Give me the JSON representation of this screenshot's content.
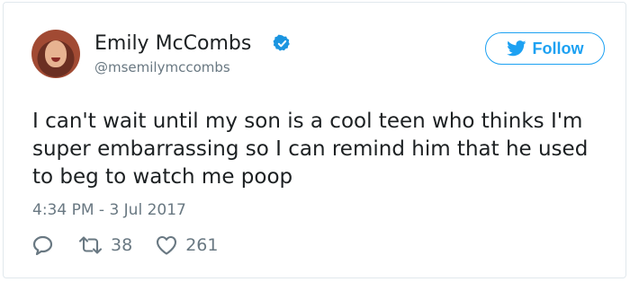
{
  "user": {
    "display_name": "Emily McCombs",
    "handle": "@msemilymccombs",
    "verified": true,
    "avatar_icon": "user-avatar-photo"
  },
  "follow_button": {
    "label": "Follow",
    "icon": "twitter-bird-icon"
  },
  "tweet": {
    "text": "I can't wait until my son is a cool teen who thinks I'm super embarrassing so I can remind him that he used to beg to watch me poop",
    "timestamp": "4:34 PM - 3 Jul 2017"
  },
  "actions": {
    "reply_icon": "reply-icon",
    "retweet_icon": "retweet-icon",
    "retweet_count": "38",
    "like_icon": "heart-icon",
    "like_count": "261"
  },
  "colors": {
    "twitter_blue": "#1da1f2",
    "verified_blue": "#1b95e0",
    "muted_text": "#697882",
    "border": "#e1e8ed"
  }
}
